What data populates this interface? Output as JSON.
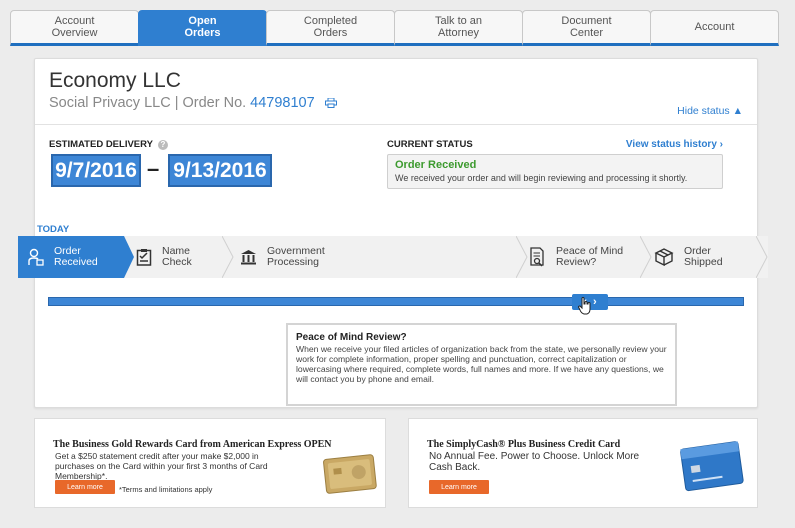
{
  "tabs": [
    {
      "label": "Account\nOverview",
      "active": false
    },
    {
      "label": "Open\nOrders",
      "active": true
    },
    {
      "label": "Completed\nOrders",
      "active": false
    },
    {
      "label": "Talk to an\nAttorney",
      "active": false
    },
    {
      "label": "Document\nCenter",
      "active": false
    },
    {
      "label": "Account",
      "active": false
    }
  ],
  "order": {
    "company": "Economy LLC",
    "subtitle_prefix": "Social Privacy LLC | Order No.",
    "order_number": "44798107",
    "hide_status": "Hide status ▲"
  },
  "delivery": {
    "label": "ESTIMATED DELIVERY",
    "help": "?",
    "from": "9/7/2016",
    "dash": "–",
    "to": "9/13/2016"
  },
  "status": {
    "label": "CURRENT STATUS",
    "history_link": "View status history ›",
    "title": "Order Received",
    "description": "We received your order and will begin reviewing and processing it shortly."
  },
  "today_label": "TODAY",
  "steps": [
    {
      "label": "Order\nReceived",
      "icon": "lock-person-icon",
      "active": true
    },
    {
      "label": "Name\nCheck",
      "icon": "clipboard-check-icon",
      "active": false
    },
    {
      "label": "Government\nProcessing",
      "icon": "government-building-icon",
      "active": false
    },
    {
      "label": "Peace of Mind\nReview?",
      "icon": "document-search-icon",
      "active": false
    },
    {
      "label": "Order\nShipped",
      "icon": "package-icon",
      "active": false
    }
  ],
  "slider": {
    "left_arrow": "‹",
    "right_arrow": "›",
    "position_fraction": 0.82
  },
  "info": {
    "title": "Peace of Mind Review?",
    "text": "When we receive your filed articles of organization back from the state, we personally review your work for complete information, proper spelling and punctuation, correct capitalization or lowercasing where required, complete words, full names and more. If we have any questions, we will contact you by phone and email."
  },
  "ads": {
    "left": {
      "title": "The Business Gold Rewards Card from American Express OPEN",
      "desc": "Get a $250 statement credit after your make $2,000 in purchases on the Card within your first 3 months of Card Membership*.",
      "button": "Learn more",
      "note": "*Terms and limitations apply"
    },
    "right": {
      "title": "The SimplyCash® Plus Business Credit Card",
      "desc": "No Annual Fee. Power to Choose. Unlock More Cash Back.",
      "button": "Learn more"
    }
  },
  "colors": {
    "primary": "#2f7fd0",
    "status_green": "#3c9a2e",
    "button_orange": "#e8682a"
  }
}
